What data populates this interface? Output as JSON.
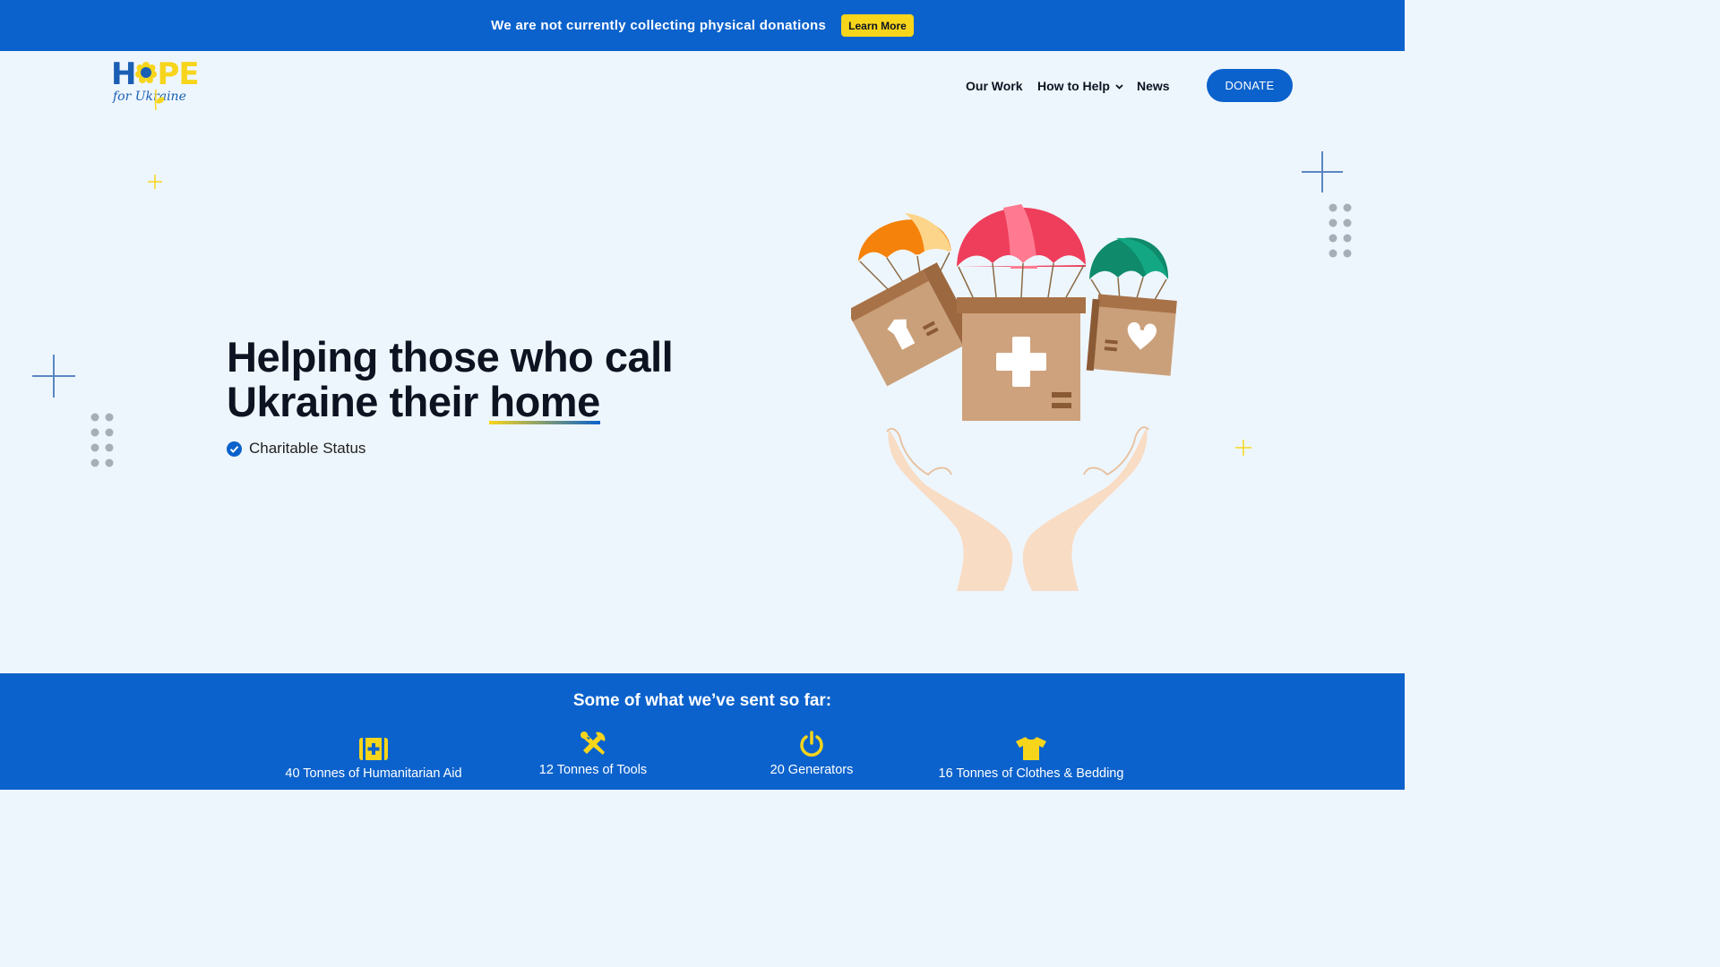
{
  "banner": {
    "message": "We are not currently collecting physical donations",
    "button_label": "Learn More"
  },
  "logo": {
    "word_part1": "H",
    "word_part2": "PE",
    "subtitle": "for Ukraine"
  },
  "nav": {
    "items": [
      {
        "label": "Our Work"
      },
      {
        "label": "How to Help"
      },
      {
        "label": "News"
      }
    ],
    "donate_label": "DONATE"
  },
  "hero": {
    "title_line1": "Helping those who call",
    "title_line2_prefix": "Ukraine their ",
    "title_highlight": "home",
    "status_label": "Charitable Status",
    "illustration": "parachute-aid-boxes-and-hands"
  },
  "stats": {
    "title": "Some of what we’ve sent so far:",
    "items": [
      {
        "icon": "first-aid-kit-icon",
        "label": "40 Tonnes of Humanitarian Aid"
      },
      {
        "icon": "tools-icon",
        "label": "12 Tonnes of Tools"
      },
      {
        "icon": "power-icon",
        "label": "20 Generators"
      },
      {
        "icon": "tshirt-icon",
        "label": "16 Tonnes of Clothes & Bedding"
      }
    ]
  },
  "colors": {
    "brand_blue": "#0b62cc",
    "brand_yellow": "#f7d51b",
    "background": "#eef6fd"
  }
}
